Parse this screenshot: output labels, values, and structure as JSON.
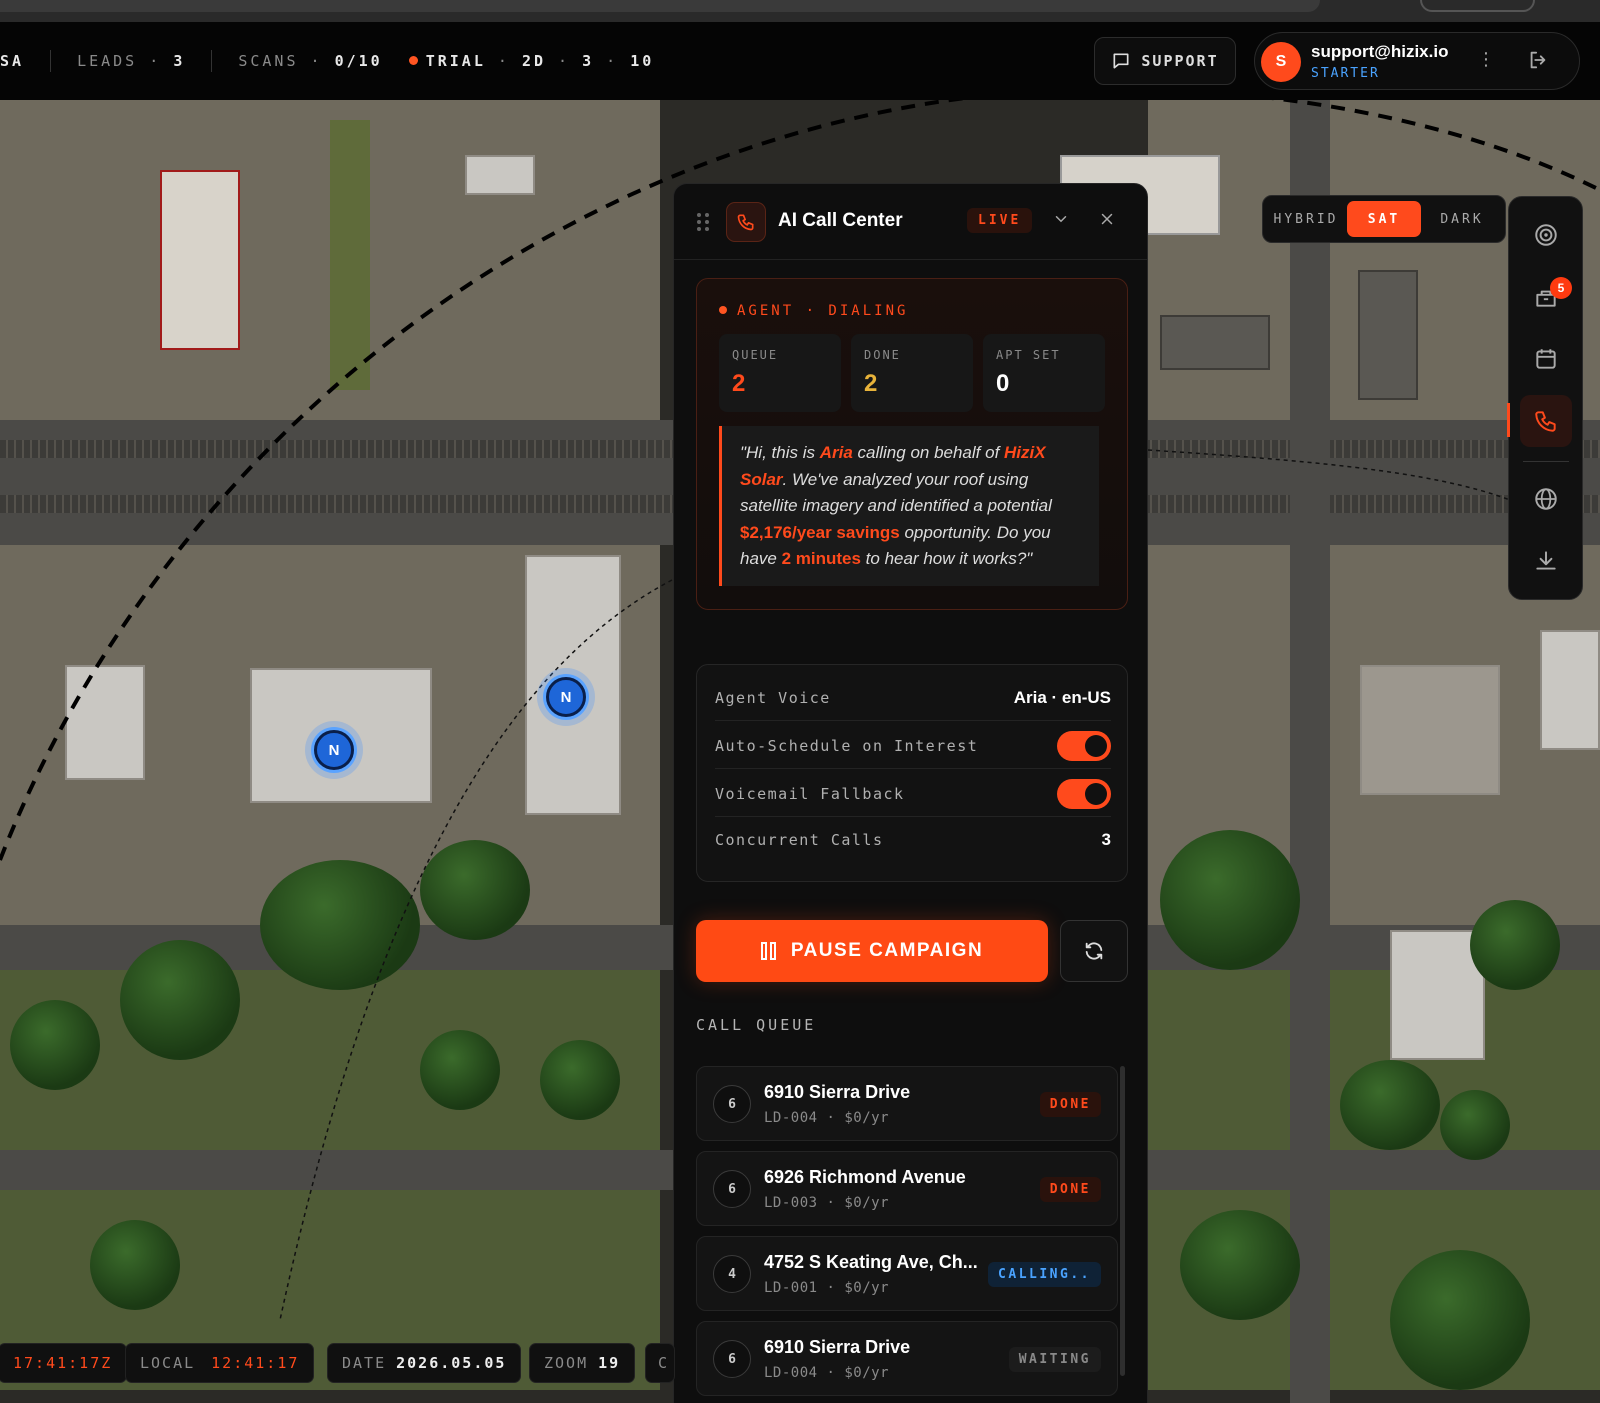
{
  "topbar": {
    "region_tail": "SA",
    "leads_label": "LEADS",
    "leads_value": "3",
    "scans_label": "SCANS",
    "scans_value": "0/10",
    "trial_label": "TRIAL",
    "trial_parts": [
      "2D",
      "3",
      "10"
    ],
    "support_label": "SUPPORT",
    "user_initial": "S",
    "user_email": "support@hizix.io",
    "user_plan": "STARTER"
  },
  "map": {
    "markers": [
      {
        "label": "N"
      },
      {
        "label": "N"
      }
    ],
    "style_options": [
      {
        "label": "HYBRID",
        "active": false
      },
      {
        "label": "SAT",
        "active": true
      },
      {
        "label": "DARK",
        "active": false
      }
    ]
  },
  "rail": {
    "items": [
      {
        "icon": "target-icon"
      },
      {
        "icon": "inbox-icon",
        "badge": "5"
      },
      {
        "icon": "calendar-icon"
      },
      {
        "icon": "phone-icon",
        "active": true
      },
      {
        "icon": "globe-icon"
      },
      {
        "icon": "download-icon"
      }
    ]
  },
  "panel": {
    "title": "AI Call Center",
    "live_badge": "LIVE",
    "agent_status": "AGENT · DIALING",
    "stats": [
      {
        "label": "QUEUE",
        "value": "2",
        "color": "#ff4a1c"
      },
      {
        "label": "DONE",
        "value": "2",
        "color": "#e8b33a"
      },
      {
        "label": "APT SET",
        "value": "0",
        "color": "#ffffff"
      }
    ],
    "script": {
      "p1": "\"Hi, this is ",
      "agent_name": "Aria",
      "p2": " calling on behalf of ",
      "company": "HiziX Solar",
      "p3": ". We've analyzed your roof using satellite imagery and identified a potential ",
      "savings": "$2,176/year savings",
      "p4": " opportunity. Do you have ",
      "duration": "2 minutes",
      "p5": " to hear how it works?\""
    },
    "settings": {
      "agent_voice_label": "Agent Voice",
      "agent_voice_value": "Aria · en-US",
      "auto_schedule_label": "Auto-Schedule on Interest",
      "auto_schedule_on": true,
      "voicemail_label": "Voicemail Fallback",
      "voicemail_on": true,
      "concurrent_label": "Concurrent Calls",
      "concurrent_value": "3"
    },
    "pause_label": "PAUSE CAMPAIGN",
    "queue_title": "CALL QUEUE",
    "queue": [
      {
        "num": "6",
        "address": "6910 Sierra Drive",
        "meta": "LD-004 · $0/yr",
        "status": "DONE",
        "kind": "done"
      },
      {
        "num": "6",
        "address": "6926 Richmond Avenue",
        "meta": "LD-003 · $0/yr",
        "status": "DONE",
        "kind": "done"
      },
      {
        "num": "4",
        "address": "4752 S Keating Ave, Ch...",
        "meta": "LD-001 · $0/yr",
        "status": "CALLING..",
        "kind": "calling"
      },
      {
        "num": "6",
        "address": "6910 Sierra Drive",
        "meta": "LD-004 · $0/yr",
        "status": "WAITING",
        "kind": "waiting"
      }
    ]
  },
  "footer": {
    "utc_value": "17:41:17Z",
    "local_label": "LOCAL",
    "local_value": "12:41:17",
    "date_label": "DATE",
    "date_value": "2026.05.05",
    "zoom_label": "ZOOM",
    "zoom_value": "19",
    "partial_label": "C"
  },
  "colors": {
    "accent": "#ff4a1c",
    "info": "#4aa3ff",
    "gold": "#e8b33a"
  }
}
